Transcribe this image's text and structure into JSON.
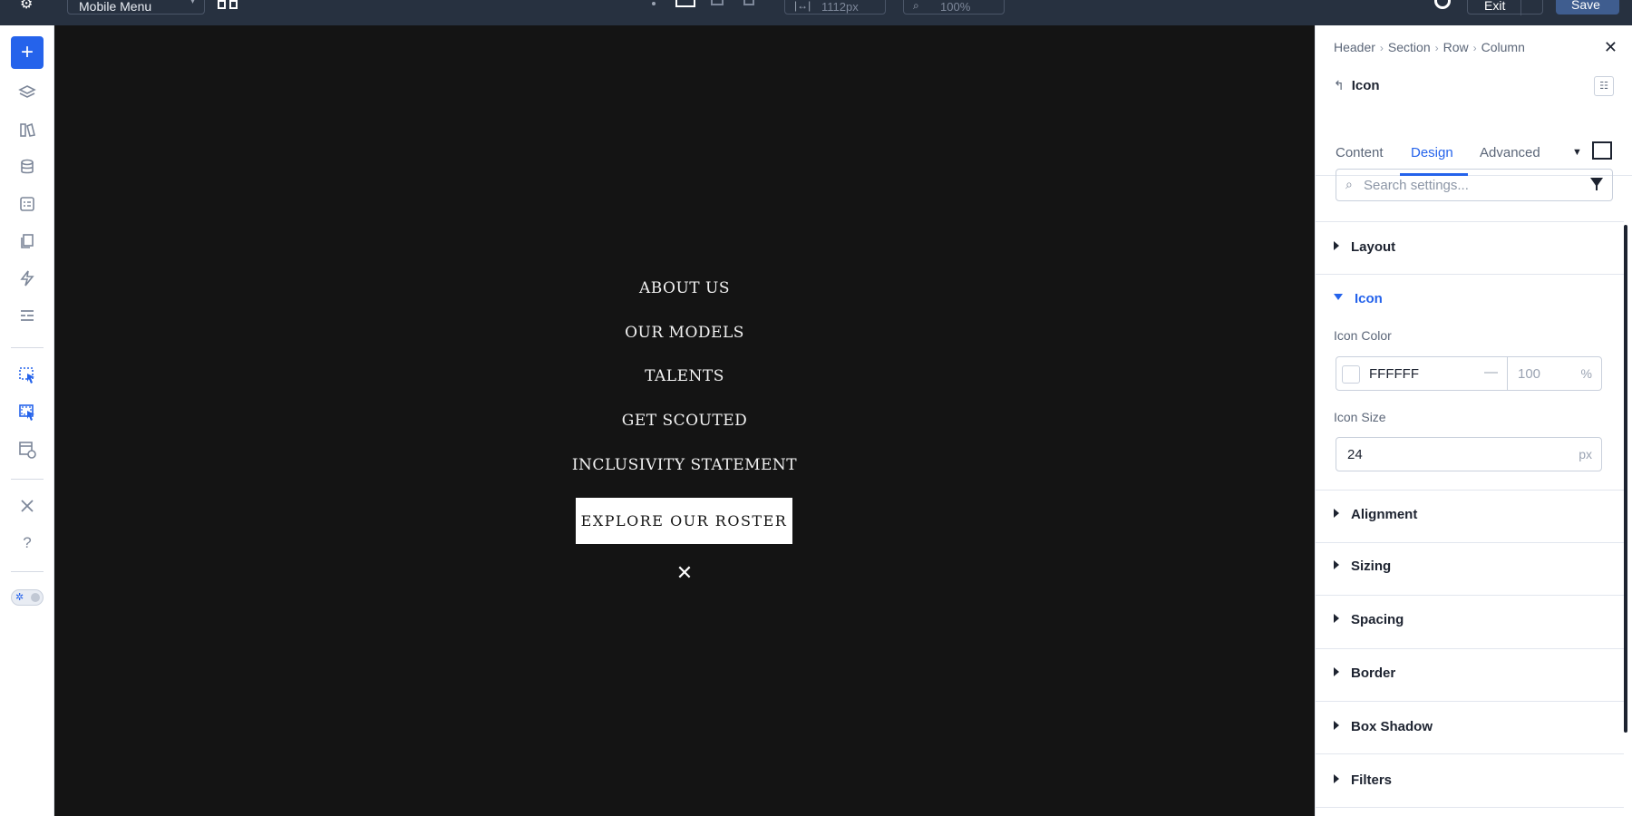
{
  "topbar": {
    "menu_select": "Mobile Menu",
    "width_value": "1112px",
    "zoom_value": "100%",
    "exit_label": "Exit",
    "save_label": "Save"
  },
  "rail": {
    "icons": [
      "add-icon",
      "layers-icon",
      "library-icon",
      "database-icon",
      "form-icon",
      "pages-icon",
      "lightning-icon",
      "list-icon",
      "select-tool-icon",
      "multi-select-icon",
      "preview-icon",
      "tools-icon",
      "help-icon",
      "theme-toggle"
    ]
  },
  "canvas": {
    "menu_items": [
      "ABOUT US",
      "OUR MODELS",
      "TALENTS",
      "GET SCOUTED",
      "INCLUSIVITY STATEMENT"
    ],
    "cta_label": "EXPLORE OUR ROSTER",
    "close_glyph": "✕",
    "background": "#141414"
  },
  "panel": {
    "breadcrumbs": [
      "Header",
      "Section",
      "Row",
      "Column"
    ],
    "element_name": "Icon",
    "tabs": [
      "Content",
      "Design",
      "Advanced"
    ],
    "active_tab": "Design",
    "search_placeholder": "Search settings...",
    "sections": {
      "layout": "Layout",
      "icon": "Icon",
      "alignment": "Alignment",
      "sizing": "Sizing",
      "spacing": "Spacing",
      "border": "Border",
      "box_shadow": "Box Shadow",
      "filters": "Filters"
    },
    "icon_color_label": "Icon Color",
    "icon_color_hex": "FFFFFF",
    "icon_color_dash": "—",
    "icon_opacity": "100",
    "icon_opacity_unit": "%",
    "icon_size_label": "Icon Size",
    "icon_size_value": "24",
    "icon_size_unit": "px",
    "accent": "#2563eb"
  }
}
